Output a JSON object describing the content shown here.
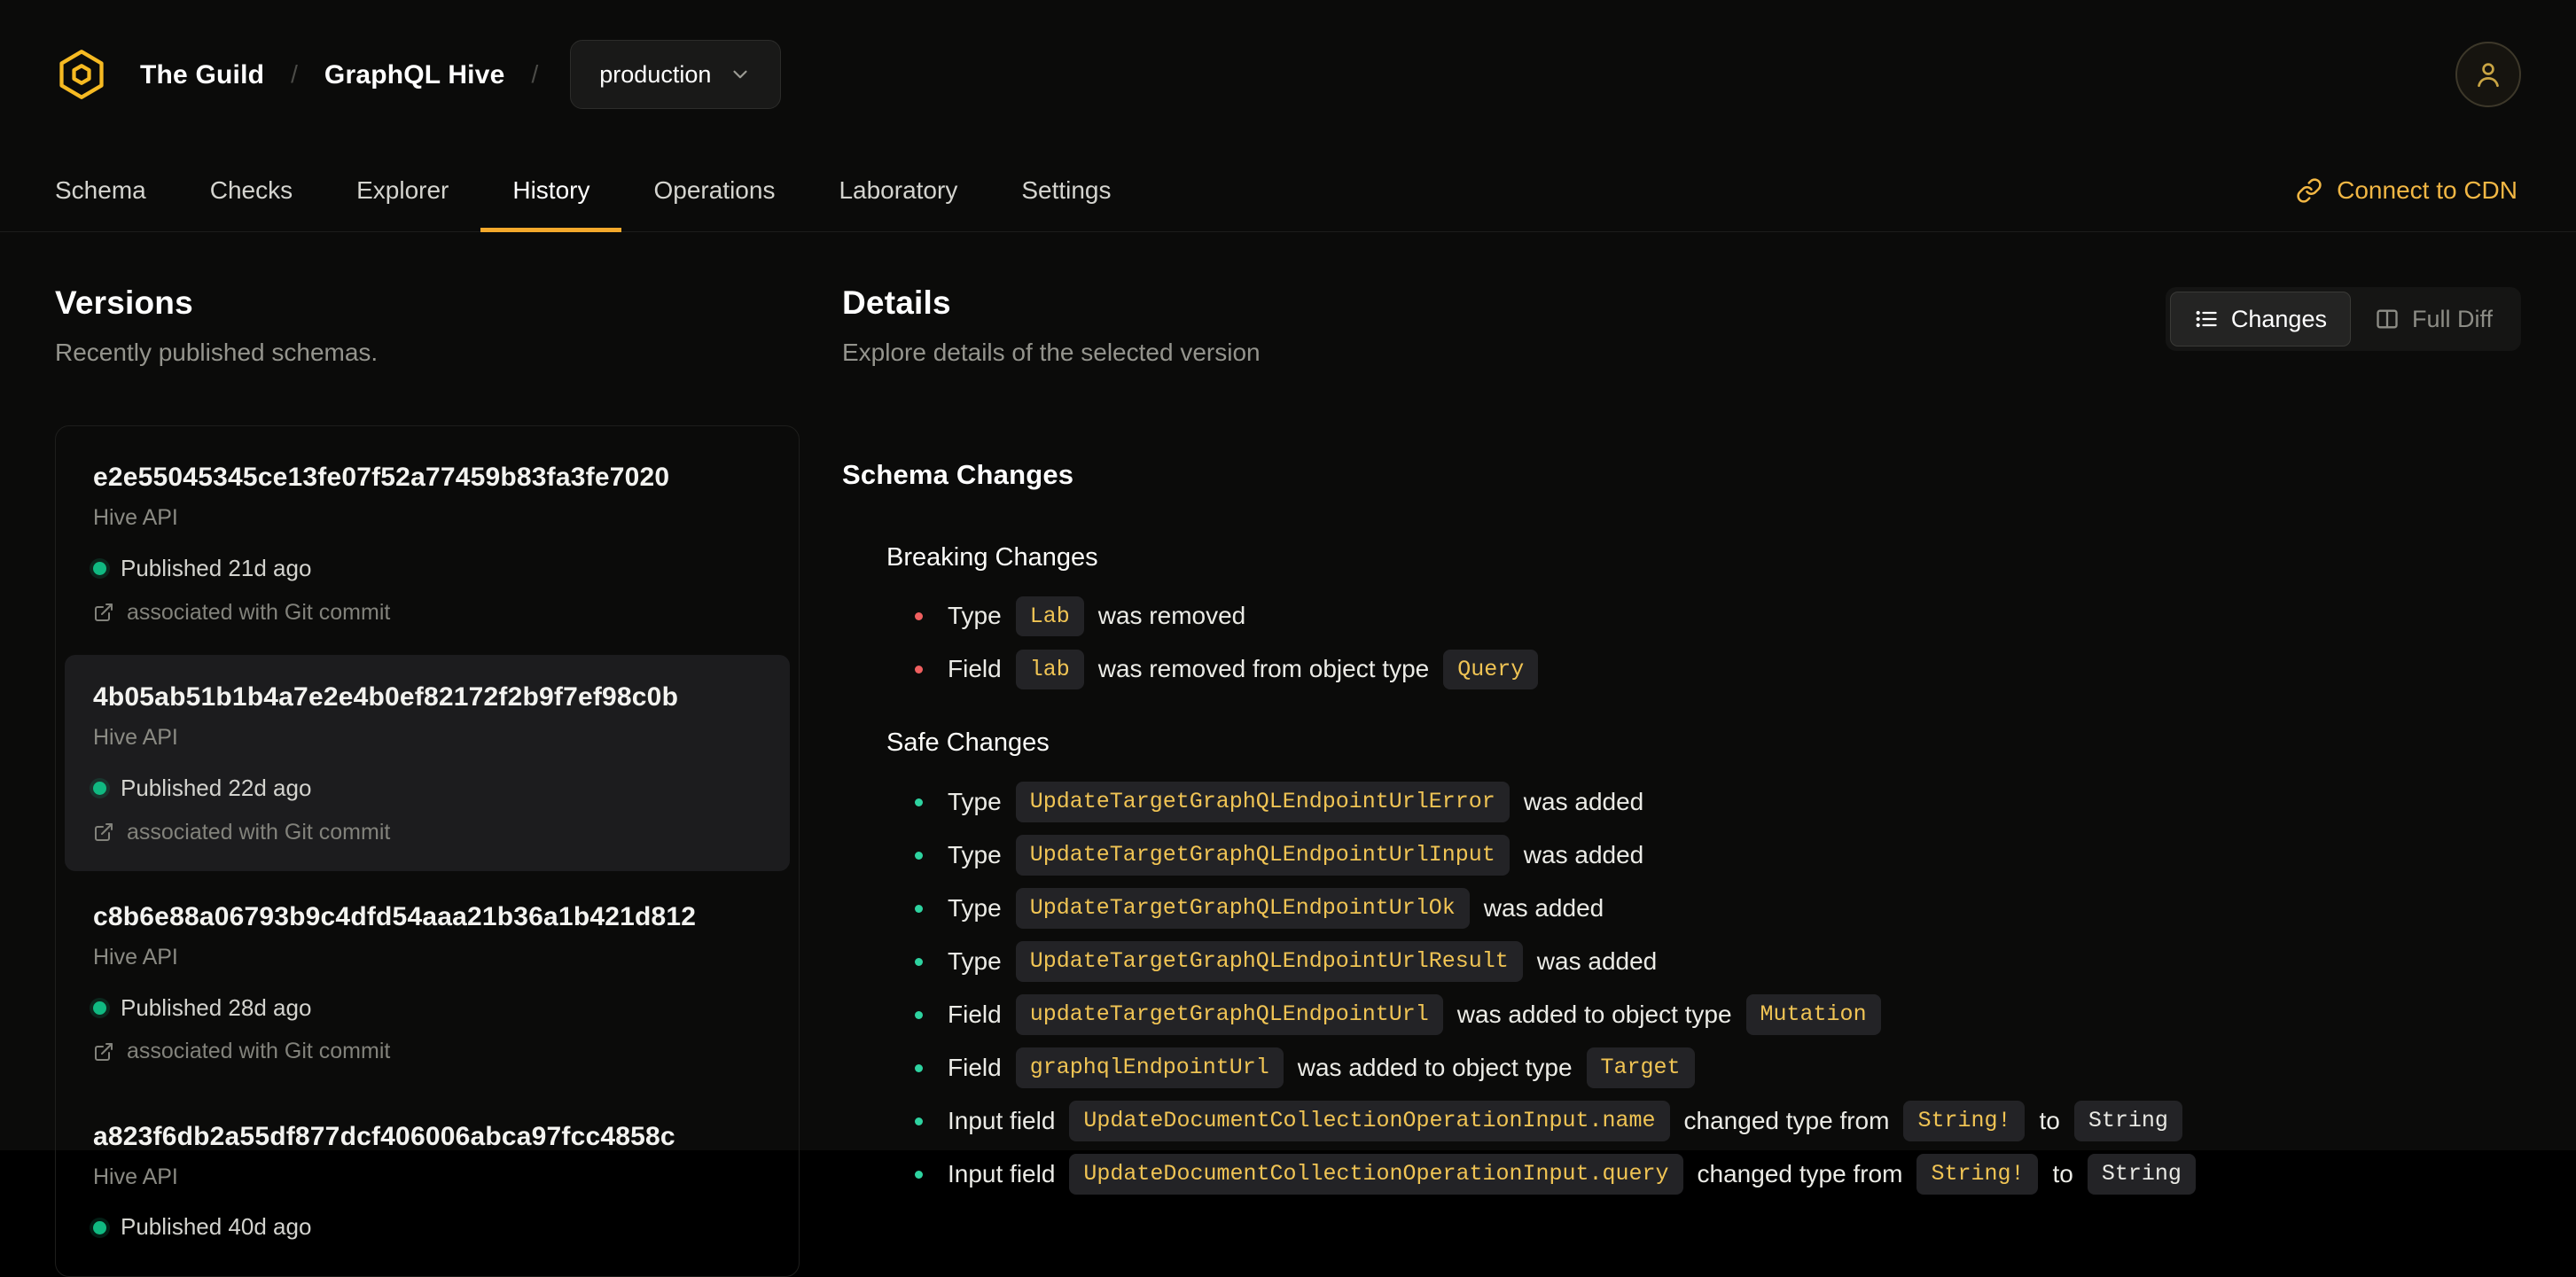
{
  "colors": {
    "accent": "#f4a92c",
    "accent_text": "#f2b744",
    "logo_yellow": "#f6ba22",
    "code_text": "#f0c454",
    "status_green": "#10b981",
    "breaking_red": "#ef5f5f",
    "safe_green": "#2ed3a0"
  },
  "header": {
    "logo_icon": "hive-logo",
    "org": "The Guild",
    "separator": "/",
    "project": "GraphQL Hive",
    "target": {
      "label": "production",
      "icon": "chevron-down-icon"
    },
    "avatar_icon": "user-icon"
  },
  "nav": {
    "tabs": [
      {
        "label": "Schema",
        "active": false
      },
      {
        "label": "Checks",
        "active": false
      },
      {
        "label": "Explorer",
        "active": false
      },
      {
        "label": "History",
        "active": true
      },
      {
        "label": "Operations",
        "active": false
      },
      {
        "label": "Laboratory",
        "active": false
      },
      {
        "label": "Settings",
        "active": false
      }
    ],
    "cdn_link": {
      "label": "Connect to CDN",
      "icon": "link-icon"
    }
  },
  "versions": {
    "title": "Versions",
    "subtitle": "Recently published schemas.",
    "items": [
      {
        "hash": "e2e55045345ce13fe07f52a77459b83fa3fe7020",
        "service": "Hive API",
        "published": "Published 21d ago",
        "git": "associated with Git commit",
        "selected": false
      },
      {
        "hash": "4b05ab51b1b4a7e2e4b0ef82172f2b9f7ef98c0b",
        "service": "Hive API",
        "published": "Published 22d ago",
        "git": "associated with Git commit",
        "selected": true
      },
      {
        "hash": "c8b6e88a06793b9c4dfd54aaa21b36a1b421d812",
        "service": "Hive API",
        "published": "Published 28d ago",
        "git": "associated with Git commit",
        "selected": false
      },
      {
        "hash": "a823f6db2a55df877dcf406006abca97fcc4858c",
        "service": "Hive API",
        "published": "Published 40d ago",
        "git": null,
        "selected": false
      }
    ]
  },
  "details": {
    "title": "Details",
    "subtitle": "Explore details of the selected version",
    "view_toggle": [
      {
        "label": "Changes",
        "icon": "list-icon",
        "active": true
      },
      {
        "label": "Full Diff",
        "icon": "diff-icon",
        "active": false
      }
    ],
    "section_title": "Schema Changes",
    "groups": [
      {
        "title": "Breaking Changes",
        "severity": "breaking",
        "items": [
          [
            {
              "text": "Type"
            },
            {
              "code": "Lab"
            },
            {
              "text": "was removed"
            }
          ],
          [
            {
              "text": "Field"
            },
            {
              "code": "lab"
            },
            {
              "text": "was removed from object type"
            },
            {
              "code": "Query"
            }
          ]
        ]
      },
      {
        "title": "Safe Changes",
        "severity": "safe",
        "items": [
          [
            {
              "text": "Type"
            },
            {
              "code": "UpdateTargetGraphQLEndpointUrlError"
            },
            {
              "text": "was added"
            }
          ],
          [
            {
              "text": "Type"
            },
            {
              "code": "UpdateTargetGraphQLEndpointUrlInput"
            },
            {
              "text": "was added"
            }
          ],
          [
            {
              "text": "Type"
            },
            {
              "code": "UpdateTargetGraphQLEndpointUrlOk"
            },
            {
              "text": "was added"
            }
          ],
          [
            {
              "text": "Type"
            },
            {
              "code": "UpdateTargetGraphQLEndpointUrlResult"
            },
            {
              "text": "was added"
            }
          ],
          [
            {
              "text": "Field"
            },
            {
              "code": "updateTargetGraphQLEndpointUrl"
            },
            {
              "text": "was added to object type"
            },
            {
              "code": "Mutation"
            }
          ],
          [
            {
              "text": "Field"
            },
            {
              "code": "graphqlEndpointUrl"
            },
            {
              "text": "was added to object type"
            },
            {
              "code": "Target"
            }
          ],
          [
            {
              "text": "Input field"
            },
            {
              "code": "UpdateDocumentCollectionOperationInput.name"
            },
            {
              "text": "changed type from"
            },
            {
              "code": "String!"
            },
            {
              "text": "to"
            },
            {
              "code": "String",
              "plain": true
            }
          ],
          [
            {
              "text": "Input field"
            },
            {
              "code": "UpdateDocumentCollectionOperationInput.query"
            },
            {
              "text": "changed type from"
            },
            {
              "code": "String!"
            },
            {
              "text": "to"
            },
            {
              "code": "String",
              "plain": true
            }
          ]
        ]
      }
    ]
  }
}
